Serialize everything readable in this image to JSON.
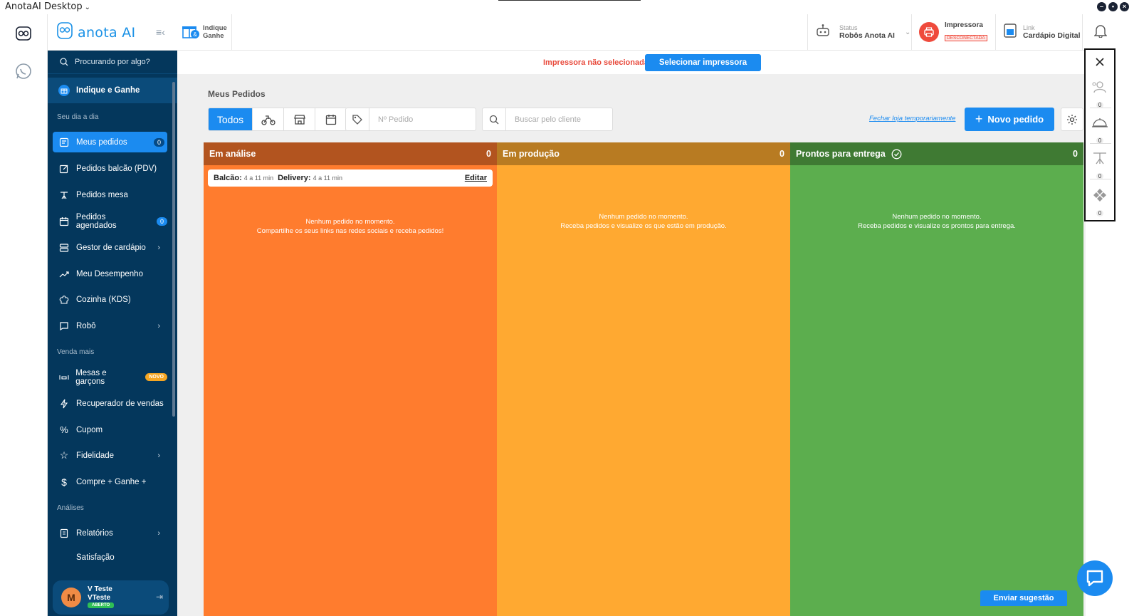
{
  "window": {
    "title": "AnotaAI Desktop"
  },
  "brand": {
    "logo_text": "anota AI"
  },
  "sidebar": {
    "search_placeholder": "Procurando por algo?",
    "promo_item": "Indique e Ganhe",
    "sections": {
      "day": "Seu dia a dia",
      "sell_more": "Venda mais",
      "analysis": "Análises"
    },
    "items": [
      {
        "label": "Meus pedidos",
        "badge": "0"
      },
      {
        "label": "Pedidos balcão (PDV)"
      },
      {
        "label": "Pedidos mesa"
      },
      {
        "label": "Pedidos agendados",
        "badge": "0"
      },
      {
        "label": "Gestor de cardápio"
      },
      {
        "label": "Meu Desempenho"
      },
      {
        "label": "Cozinha (KDS)"
      },
      {
        "label": "Robô"
      },
      {
        "label": "Mesas e garçons",
        "new_badge": "NOVO"
      },
      {
        "label": "Recuperador de vendas"
      },
      {
        "label": "Cupom"
      },
      {
        "label": "Fidelidade"
      },
      {
        "label": "Compre + Ganhe +"
      },
      {
        "label": "Relatórios"
      },
      {
        "label": "Satisfação"
      }
    ],
    "user": {
      "initial": "M",
      "name": "V Teste",
      "store": "VTeste",
      "status": "ABERTO"
    }
  },
  "topbar": {
    "indique": {
      "line1": "Indique",
      "line2": "Ganhe"
    },
    "status": {
      "label": "Status",
      "value": "Robôs Anota AI"
    },
    "printer": {
      "label": "Impressora",
      "status": "DESCONECTADA"
    },
    "link": {
      "label": "Link",
      "value": "Cardápio Digital"
    }
  },
  "notice": {
    "message": "Impressora não selecionada",
    "button": "Selecionar impressora"
  },
  "main": {
    "title": "Meus Pedidos",
    "filter_all": "Todos",
    "order_number_placeholder": "Nº Pedido",
    "customer_search_placeholder": "Buscar pelo cliente",
    "close_store_link": "Fechar loja temporariamente",
    "new_order_button": "Novo pedido",
    "columns": [
      {
        "title": "Em análise",
        "count": "0",
        "empty_line1": "Nenhum pedido no momento.",
        "empty_line2": "Compartilhe os seus links nas redes sociais e receba pedidos!"
      },
      {
        "title": "Em produção",
        "count": "0",
        "empty_line1": "Nenhum pedido no momento.",
        "empty_line2": "Receba pedidos e visualize os que estão em produção."
      },
      {
        "title": "Prontos para entrega",
        "count": "0",
        "empty_line1": "Nenhum pedido no momento.",
        "empty_line2": "Receba pedidos e visualize os prontos para entrega."
      }
    ],
    "times": {
      "counter_label": "Balcão:",
      "counter_value": "4 a 11 min",
      "delivery_label": "Delivery:",
      "delivery_value": "4 a 11 min",
      "edit": "Editar"
    }
  },
  "right_panel": {
    "counts": [
      "0",
      "0",
      "0",
      "0"
    ]
  },
  "feedback_button": "Enviar sugestão",
  "colors": {
    "accent": "#1b8bf0",
    "sidebar": "#04375c",
    "analysis": "#ff7c2e",
    "production": "#ffa931",
    "ready": "#5cae4e",
    "alert": "#ef4a3c"
  }
}
